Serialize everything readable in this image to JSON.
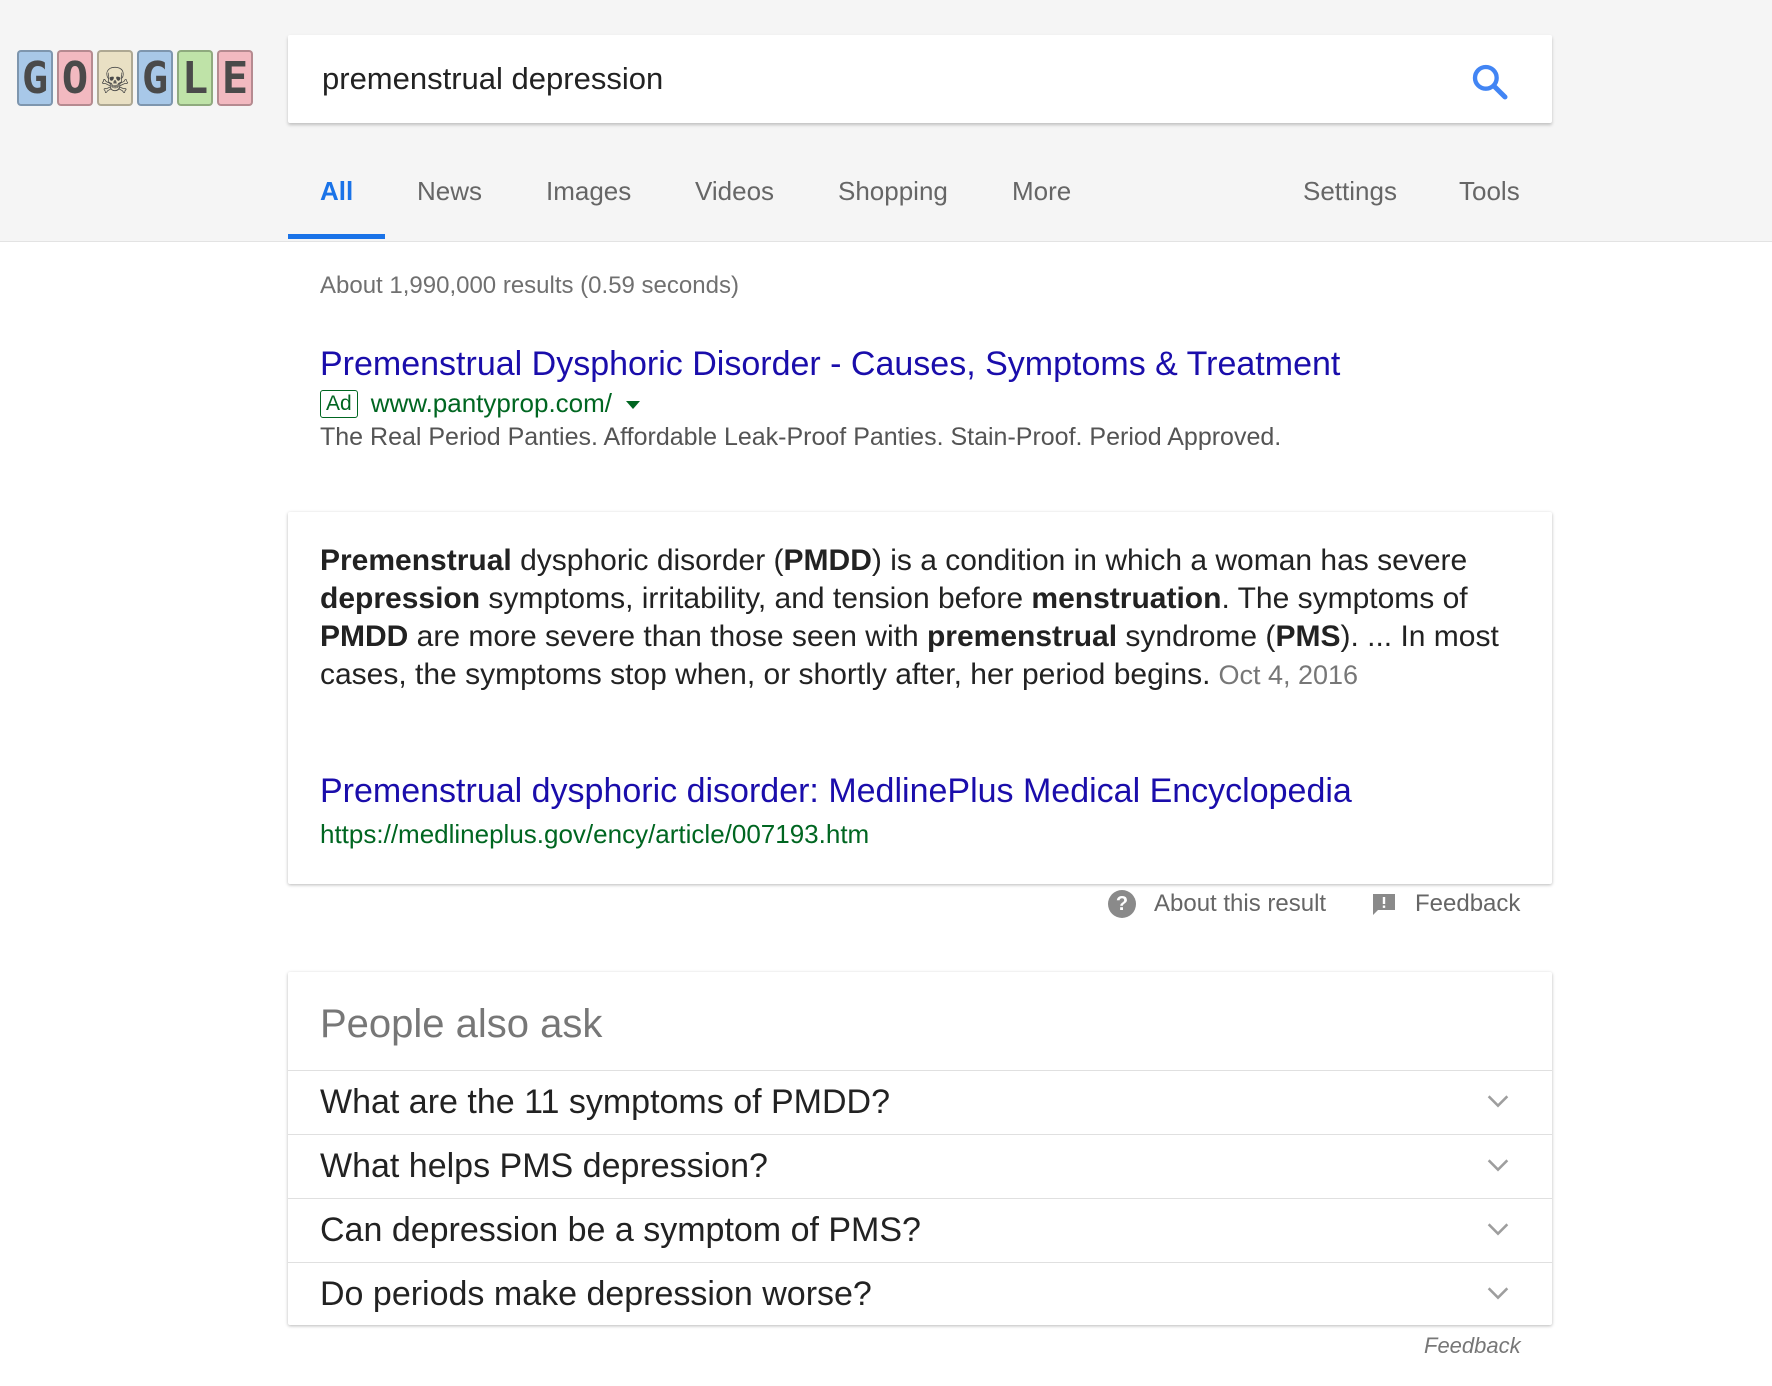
{
  "logo": {
    "letters": [
      "G",
      "O",
      "☠",
      "G",
      "L",
      "E"
    ]
  },
  "search": {
    "query": "premenstrual depression"
  },
  "tabs": [
    {
      "label": "All"
    },
    {
      "label": "News"
    },
    {
      "label": "Images"
    },
    {
      "label": "Videos"
    },
    {
      "label": "Shopping"
    },
    {
      "label": "More"
    }
  ],
  "tools_nav": {
    "settings_label": "Settings",
    "tools_label": "Tools"
  },
  "result_stats": "About 1,990,000 results (0.59 seconds)",
  "ad": {
    "title": "Premenstrual Dysphoric Disorder - Causes, Symptoms & Treatment",
    "badge": "Ad",
    "url": "www.pantyprop.com/",
    "description": "The Real Period Panties. Affordable Leak-Proof Panties. Stain-Proof. Period Approved."
  },
  "featured_snippet": {
    "segments": [
      {
        "text": "Premenstrual",
        "bold": true
      },
      {
        "text": " dysphoric disorder (",
        "bold": false
      },
      {
        "text": "PMDD",
        "bold": true
      },
      {
        "text": ") is a condition in which a woman has severe ",
        "bold": false
      },
      {
        "text": "depression",
        "bold": true
      },
      {
        "text": " symptoms, irritability, and tension before ",
        "bold": false
      },
      {
        "text": "menstruation",
        "bold": true
      },
      {
        "text": ". The symptoms of ",
        "bold": false
      },
      {
        "text": "PMDD",
        "bold": true
      },
      {
        "text": " are more severe than those seen with ",
        "bold": false
      },
      {
        "text": "premenstrual",
        "bold": true
      },
      {
        "text": " syndrome (",
        "bold": false
      },
      {
        "text": "PMS",
        "bold": true
      },
      {
        "text": "). ... In most cases, the symptoms stop when, or shortly after, her period begins.",
        "bold": false
      }
    ],
    "date": "Oct 4, 2016",
    "source_title": "Premenstrual dysphoric disorder: MedlinePlus Medical Encyclopedia",
    "source_url": "https://medlineplus.gov/ency/article/007193.htm"
  },
  "snippet_footer": {
    "about_label": "About this result",
    "feedback_label": "Feedback"
  },
  "people_also_ask": {
    "heading": "People also ask",
    "questions": [
      "What are the 11 symptoms of PMDD?",
      "What helps PMS depression?",
      "Can depression be a symptom of PMS?",
      "Do periods make depression worse?"
    ],
    "feedback_label": "Feedback"
  },
  "colors": {
    "accent": "#1a73e8",
    "link": "#1a0dab",
    "url_green": "#006621",
    "logo_tiles": [
      "#a8c8e8",
      "#f2b9c0",
      "#e9e0c4",
      "#a8c8e8",
      "#bfe3a8",
      "#f2b9c0"
    ]
  }
}
